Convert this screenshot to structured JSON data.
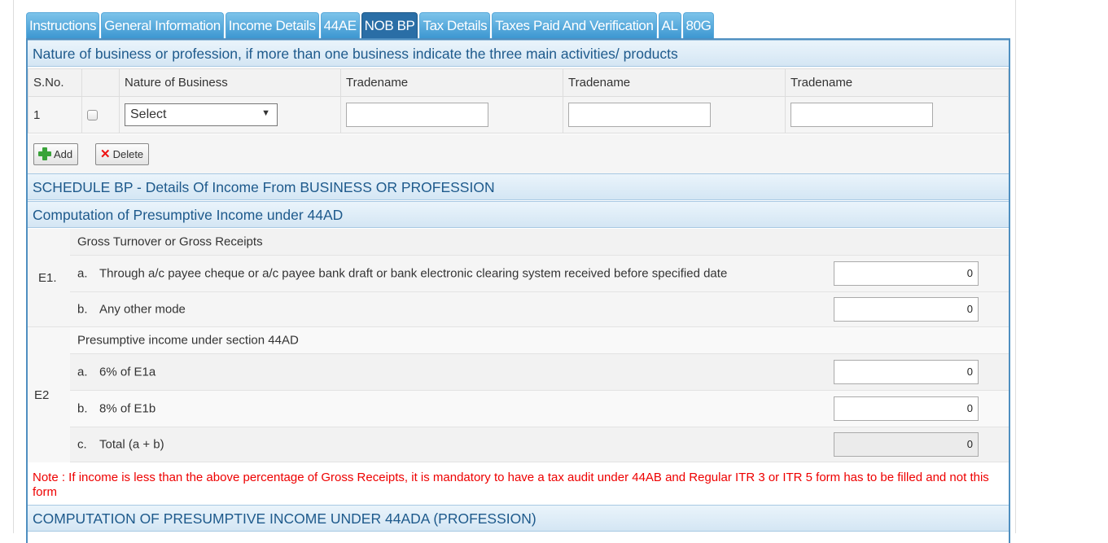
{
  "tabs": [
    {
      "label": "Instructions",
      "active": false
    },
    {
      "label": "General Information",
      "active": false
    },
    {
      "label": "Income Details",
      "active": false
    },
    {
      "label": "44AE",
      "active": false
    },
    {
      "label": "NOB BP",
      "active": true
    },
    {
      "label": "Tax Details",
      "active": false
    },
    {
      "label": "Taxes Paid And Verification",
      "active": false
    },
    {
      "label": "AL",
      "active": false
    },
    {
      "label": "80G",
      "active": false
    }
  ],
  "nob": {
    "header": "Nature of business or profession, if more than one business indicate the three main activities/ products",
    "columns": [
      "S.No.",
      "",
      "Nature of Business",
      "Tradename",
      "Tradename",
      "Tradename"
    ],
    "row": {
      "sno": "1",
      "nature_select": "Select",
      "tradenames": [
        "",
        "",
        ""
      ]
    },
    "add_label": "Add",
    "delete_label": "Delete"
  },
  "schedule_bp_header": "SCHEDULE BP - Details Of Income From BUSINESS OR PROFESSION",
  "computation_44ad": {
    "header": "Computation of Presumptive Income under 44AD",
    "e1": {
      "label": "E1.",
      "title": "Gross Turnover or Gross Receipts",
      "a": {
        "letter": "a.",
        "text": "Through a/c payee cheque or a/c payee bank draft or bank electronic clearing system received before specified date",
        "value": "0"
      },
      "b": {
        "letter": "b.",
        "text": "Any other mode",
        "value": "0"
      }
    },
    "e2": {
      "label": "E2",
      "title": "Presumptive income under section 44AD",
      "a": {
        "letter": "a.",
        "text": "6% of E1a",
        "value": "0"
      },
      "b": {
        "letter": "b.",
        "text": "8% of E1b",
        "value": "0"
      },
      "c": {
        "letter": "c.",
        "text": "Total (a + b)",
        "value": "0"
      }
    },
    "note": "Note : If income is less than the above percentage of Gross Receipts, it is mandatory to have a tax audit under 44AB and Regular ITR 3 or ITR 5 form has to be filled and not this form"
  },
  "computation_44ada_header": "COMPUTATION OF PRESUMPTIVE INCOME UNDER 44ADA (PROFESSION)",
  "colors": {
    "tab": "#3d97d1",
    "tab_active": "#2a6ea6",
    "header_text": "#1e5a8c",
    "note": "#e00000"
  }
}
